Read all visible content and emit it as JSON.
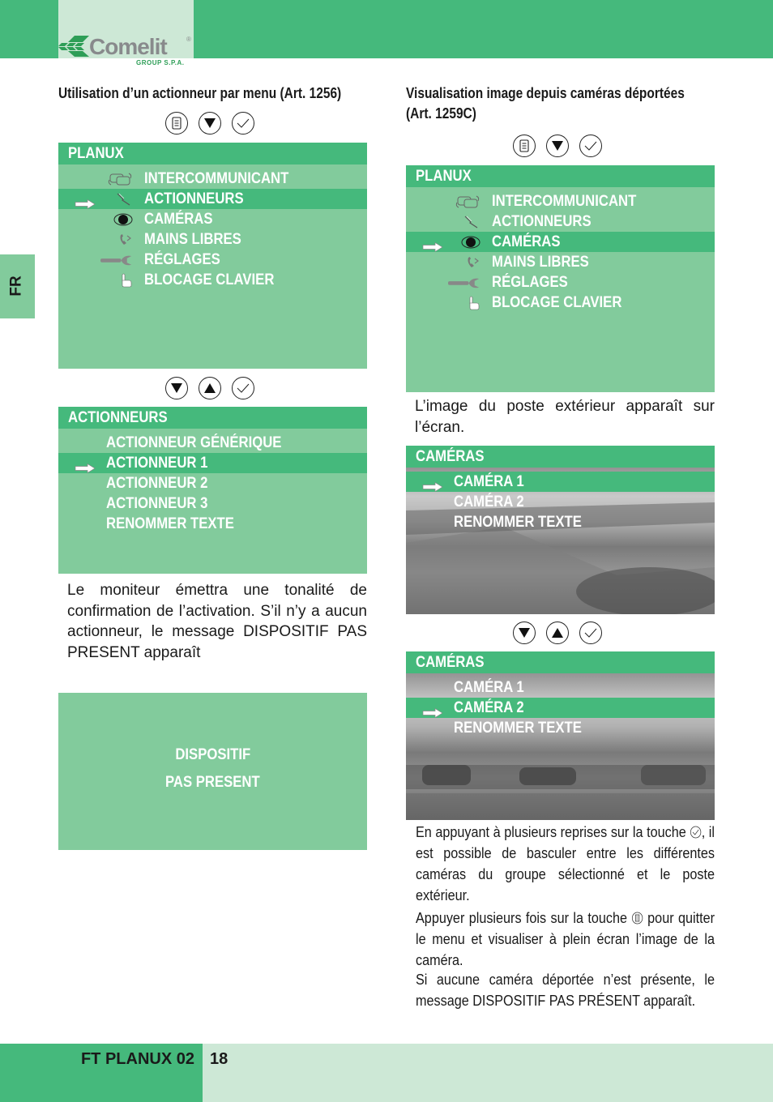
{
  "header": {
    "brand": "Comelit",
    "brand_sub": "GROUP S.P.A.",
    "registered_mark": "®"
  },
  "side_tab": {
    "label": "FR"
  },
  "left": {
    "heading": "Utilisation d’un actionneur par menu (Art. 1256)",
    "keys_1": [
      "menu-key",
      "down-key",
      "ok-key"
    ],
    "screen_1": {
      "title": "PLANUX",
      "items": [
        {
          "label": "INTERCOMMUNICANT",
          "icon": "intercom-icon",
          "selected": false
        },
        {
          "label": "ACTIONNEURS",
          "icon": "actuator-icon",
          "selected": true
        },
        {
          "label": "CAMÉRAS",
          "icon": "camera-eye-icon",
          "selected": false
        },
        {
          "label": "MAINS LIBRES",
          "icon": "handsfree-phone-icon",
          "selected": false
        },
        {
          "label": "RÉGLAGES",
          "icon": "wrench-icon",
          "selected": false
        },
        {
          "label": "BLOCAGE CLAVIER",
          "icon": "hand-pointer-icon",
          "selected": false
        }
      ]
    },
    "keys_2": [
      "down-key",
      "up-key",
      "ok-key"
    ],
    "screen_2": {
      "title": "ACTIONNEURS",
      "items": [
        {
          "label": "ACTIONNEUR GÉNÉRIQUE",
          "selected": false
        },
        {
          "label": "ACTIONNEUR 1",
          "selected": true
        },
        {
          "label": "ACTIONNEUR 2",
          "selected": false
        },
        {
          "label": "ACTIONNEUR 3",
          "selected": false
        },
        {
          "label": "RENOMMER TEXTE",
          "selected": false
        }
      ]
    },
    "paragraph": "Le moniteur émettra une tonalité de confirmation de l’activation. S’il n’y a aucun actionneur, le message DISPOSITIF PAS PRESENT apparaît",
    "screen_3": {
      "line1": "DISPOSITIF",
      "line2": "PAS PRESENT"
    }
  },
  "right": {
    "heading": "Visualisation image depuis caméras déportées (Art. 1259C)",
    "keys_1": [
      "menu-key",
      "down-key",
      "ok-key"
    ],
    "screen_1": {
      "title": "PLANUX",
      "items": [
        {
          "label": "INTERCOMMUNICANT",
          "icon": "intercom-icon",
          "selected": false
        },
        {
          "label": "ACTIONNEURS",
          "icon": "actuator-icon",
          "selected": false
        },
        {
          "label": "CAMÉRAS",
          "icon": "camera-eye-icon",
          "selected": true
        },
        {
          "label": "MAINS LIBRES",
          "icon": "handsfree-phone-icon",
          "selected": false
        },
        {
          "label": "RÉGLAGES",
          "icon": "wrench-icon",
          "selected": false
        },
        {
          "label": "BLOCAGE CLAVIER",
          "icon": "hand-pointer-icon",
          "selected": false
        }
      ]
    },
    "paragraph_1": "L’image du poste extérieur apparaît sur l’écran.",
    "screen_2": {
      "title": "CAMÉRAS",
      "items": [
        {
          "label": "CAMÉRA 1",
          "selected": true
        },
        {
          "label": "CAMÉRA 2",
          "selected": false
        },
        {
          "label": "RENOMMER TEXTE",
          "selected": false
        }
      ]
    },
    "keys_2": [
      "down-key",
      "up-key",
      "ok-key"
    ],
    "screen_3": {
      "title": "CAMÉRAS",
      "items": [
        {
          "label": "CAMÉRA 1",
          "selected": false
        },
        {
          "label": "CAMÉRA 2",
          "selected": true
        },
        {
          "label": "RENOMMER TEXTE",
          "selected": false
        }
      ]
    },
    "paragraph_2a": "En appuyant à plusieurs reprises sur la touche",
    "paragraph_2b": ", il est possible de basculer entre les différentes caméras du groupe sélectionné et le poste extérieur.",
    "paragraph_3a": "Appuyer plusieurs fois sur la touche",
    "paragraph_3b": "pour quitter le menu et visualiser à plein écran l’image de la caméra.",
    "paragraph_4": "Si aucune caméra déportée n’est présente, le message DISPOSITIF PAS PRÉSENT apparaît."
  },
  "footer": {
    "doc_title": "FT PLANUX 02",
    "page_number": "18"
  },
  "colors": {
    "green_dark": "#45b97c",
    "green_mid": "#82cb9c",
    "green_light": "#cde8d6"
  }
}
